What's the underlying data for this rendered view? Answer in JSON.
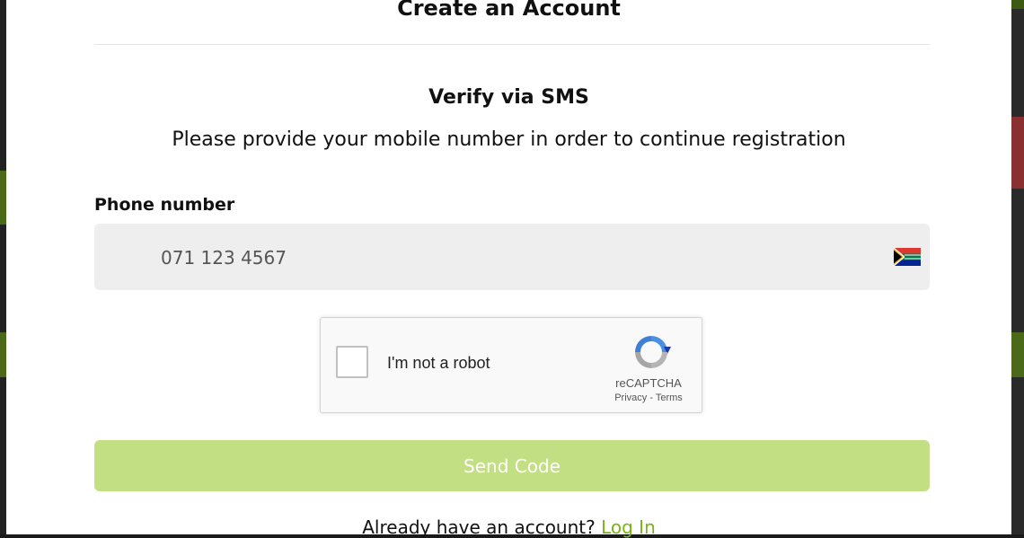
{
  "modal": {
    "title": "Create an Account"
  },
  "verify": {
    "heading": "Verify via SMS",
    "instruction": "Please provide your mobile number in order to continue registration"
  },
  "phone": {
    "label": "Phone number",
    "placeholder": "071 123 4567",
    "country_flag": "south-africa-flag-icon"
  },
  "recaptcha": {
    "checkbox_label": "I'm not a robot",
    "brand": "reCAPTCHA",
    "privacy": "Privacy",
    "separator": " - ",
    "terms": "Terms"
  },
  "actions": {
    "send_code_label": "Send Code",
    "send_code_color": "#c3df84"
  },
  "footer": {
    "prompt": "Already have an account?",
    "login_label": "Log In",
    "link_color": "#7ab317"
  }
}
